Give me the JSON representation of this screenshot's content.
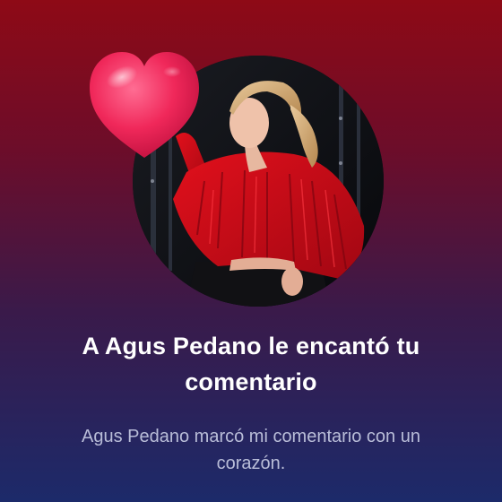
{
  "notification": {
    "title": "A Agus Pedano le encantó tu comentario",
    "subtitle": "Agus Pedano marcó mi comentario con un corazón."
  },
  "icons": {
    "reaction": "heart-icon",
    "profile": "avatar"
  },
  "colors": {
    "background_top": "#8e0a16",
    "background_bottom": "#1c2a6a",
    "heart": "#f0285a",
    "title": "#ffffff",
    "subtitle": "#b9bdd8"
  }
}
